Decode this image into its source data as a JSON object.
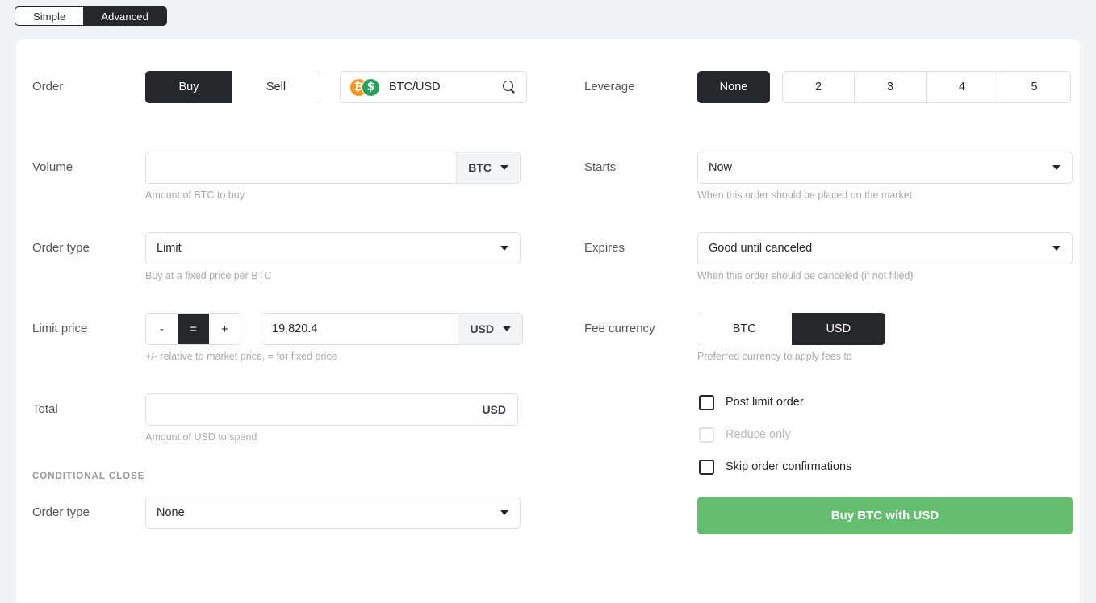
{
  "mode_toggle": {
    "simple_label": "Simple",
    "advanced_label": "Advanced",
    "selected": "Advanced"
  },
  "order": {
    "label": "Order",
    "side": {
      "buy_label": "Buy",
      "sell_label": "Sell",
      "selected": "Buy"
    },
    "pair": {
      "name": "BTC/USD",
      "base_symbol": "₿",
      "quote_symbol": "$",
      "base_color": "#f7941e",
      "quote_color": "#27a45a",
      "search_icon": "search-icon"
    }
  },
  "leverage": {
    "label": "Leverage",
    "none_label": "None",
    "options": [
      "2",
      "3",
      "4",
      "5"
    ],
    "selected": "None"
  },
  "volume": {
    "label": "Volume",
    "value": "",
    "placeholder": "",
    "currency": "BTC",
    "hint": "Amount of BTC to buy"
  },
  "starts": {
    "label": "Starts",
    "value": "Now",
    "hint": "When this order should be placed on the market"
  },
  "order_type": {
    "label": "Order type",
    "value": "Limit",
    "hint": "Buy at a fixed price per BTC"
  },
  "expires": {
    "label": "Expires",
    "value": "Good until canceled",
    "hint": "When this order should be canceled (if not filled)"
  },
  "limit_price": {
    "label": "Limit price",
    "stepper": {
      "minus_label": "-",
      "equals_label": "=",
      "plus_label": "+",
      "selected": "="
    },
    "value": "19,820.4",
    "currency": "USD",
    "hint": "+/- relative to market price, = for fixed price"
  },
  "fee_currency": {
    "label": "Fee currency",
    "btc_label": "BTC",
    "usd_label": "USD",
    "selected": "USD",
    "hint": "Preferred currency to apply fees to"
  },
  "total": {
    "label": "Total",
    "value": "",
    "placeholder": "",
    "currency": "USD",
    "hint": "Amount of USD to spend"
  },
  "options": {
    "post_limit_order": {
      "label": "Post limit order",
      "checked": false,
      "disabled": false
    },
    "reduce_only": {
      "label": "Reduce only",
      "checked": false,
      "disabled": true
    },
    "skip_order_confirmations": {
      "label": "Skip order confirmations",
      "checked": false,
      "disabled": false
    }
  },
  "conditional_close": {
    "heading": "CONDITIONAL CLOSE",
    "order_type_label": "Order type",
    "order_type_value": "None"
  },
  "submit": {
    "label": "Buy BTC with USD",
    "color": "#66bd72"
  }
}
